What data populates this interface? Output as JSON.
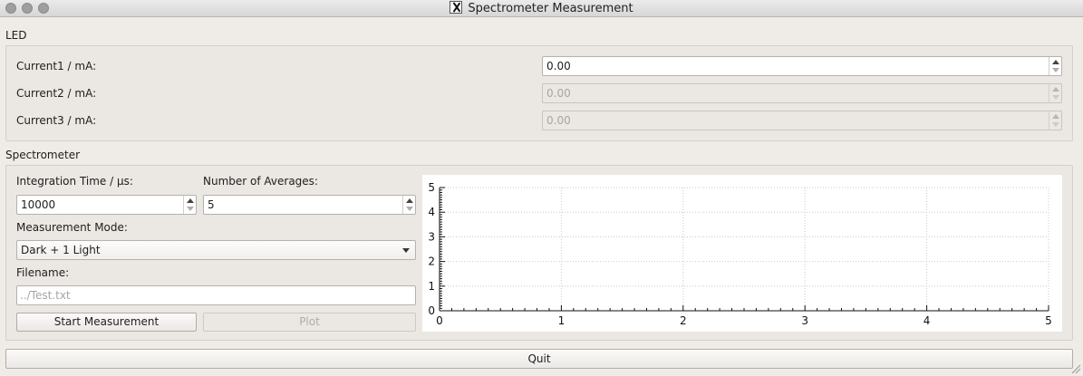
{
  "window": {
    "title": "Spectrometer Measurement"
  },
  "led": {
    "group_label": "LED",
    "current1_label": "Current1 / mA:",
    "current1_value": "0.00",
    "current2_label": "Current2 / mA:",
    "current2_value": "0.00",
    "current3_label": "Current3 / mA:",
    "current3_value": "0.00"
  },
  "spectrometer": {
    "group_label": "Spectrometer",
    "integration_label": "Integration Time / µs:",
    "integration_value": "10000",
    "averages_label": "Number of Averages:",
    "averages_value": "5",
    "mode_label": "Measurement Mode:",
    "mode_value": "Dark + 1 Light",
    "filename_label": "Filename:",
    "filename_placeholder": "../Test.txt",
    "start_button": "Start Measurement",
    "plot_button": "Plot"
  },
  "quit_button": "Quit",
  "icons": {
    "window_close": "close-dot-icon",
    "window_minimize": "minimize-dot-icon",
    "window_zoom": "zoom-dot-icon",
    "app": "x11-logo-icon",
    "spin_up": "arrow-up-icon",
    "spin_down": "arrow-down-icon",
    "dropdown": "chevron-down-icon",
    "resize": "resize-grip-icon"
  },
  "chart_data": {
    "type": "line",
    "series": [],
    "xlim": [
      0,
      5
    ],
    "ylim": [
      0,
      5
    ],
    "x_ticks": [
      "0",
      "1",
      "2",
      "3",
      "4",
      "5"
    ],
    "y_ticks": [
      "0",
      "1",
      "2",
      "3",
      "4",
      "5"
    ],
    "grid": true
  }
}
